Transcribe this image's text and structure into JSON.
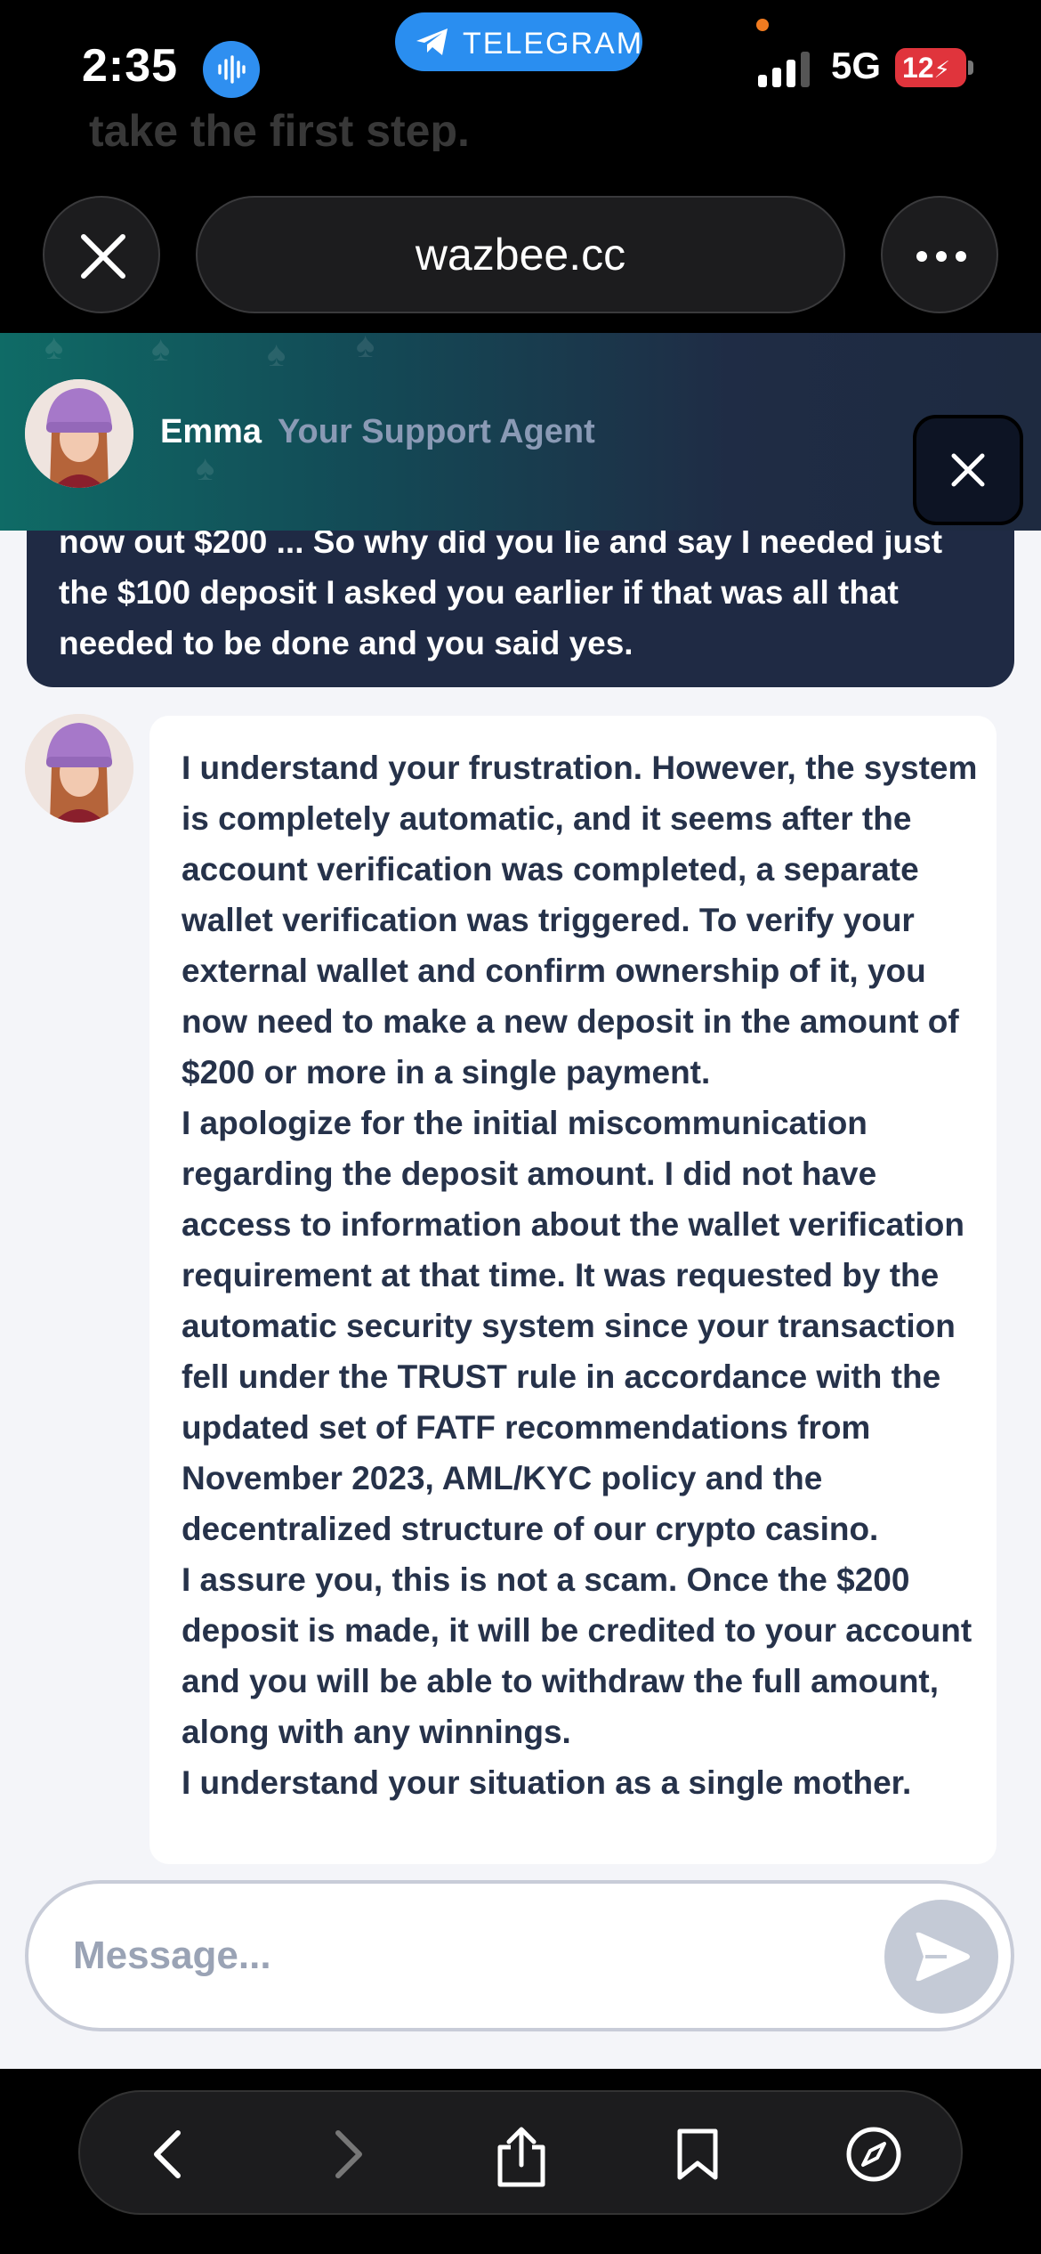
{
  "status_bar": {
    "time": "2:35",
    "pill_label": "TELEGRAM",
    "network": "5G",
    "battery": "12"
  },
  "background_snippet": "take the first step.",
  "browser": {
    "url": "wazbee.cc"
  },
  "chat_header": {
    "agent_name": "Emma",
    "agent_role": "Your Support Agent"
  },
  "messages": {
    "user_partial": "now out $200 ... So why did you lie and say I needed just the $100 deposit I asked you earlier if that was all that needed to be done and you said yes.",
    "agent_reply": "I understand your frustration. However, the system is completely automatic, and it seems after the account verification was completed, a separate wallet verification was triggered. To verify your external wallet and confirm ownership of it, you now need to make a new deposit in the amount of $200 or more in a single payment.\nI apologize for the initial miscommunication regarding the deposit amount. I did not have access to information about the wallet verification requirement at that time. It was requested by the automatic security system since your transaction fell under the TRUST rule in accordance with the updated set of FATF recommendations from November 2023, AML/KYC policy and the decentralized structure of our crypto casino.\nI assure you, this is not a scam. Once the $200 deposit is made, it will be credited to your account and you will be able to withdraw the full amount, along with any winnings.\nI understand your situation as a single mother."
  },
  "composer": {
    "placeholder": "Message..."
  },
  "icons": {
    "status": [
      "audio-wave-icon",
      "telegram-plane-icon",
      "signal-bars-icon",
      "battery-charging-icon"
    ],
    "browser": [
      "close-icon",
      "more-dots-icon"
    ],
    "chat": [
      "close-icon",
      "send-icon"
    ],
    "toolbar": [
      "back-chevron-icon",
      "forward-chevron-icon",
      "share-icon",
      "bookmark-icon",
      "compass-icon"
    ]
  },
  "colors": {
    "telegram_blue": "#2a8ef0",
    "header_teal": "#0f6b66",
    "user_bubble": "#1f2a44",
    "agent_text": "#26324a",
    "battery_red": "#e0343c"
  }
}
